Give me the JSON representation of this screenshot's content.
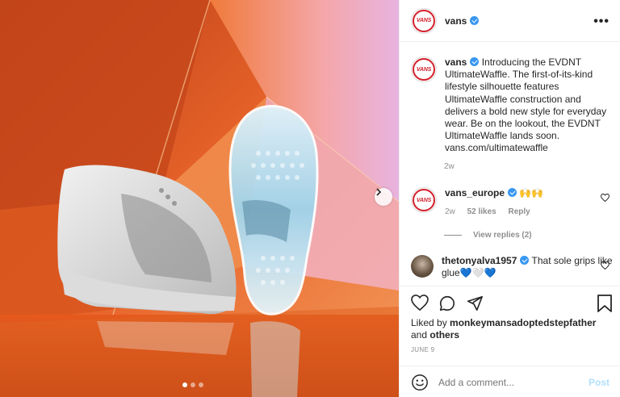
{
  "post": {
    "author": "vans",
    "author_logo_text": "VANS",
    "caption": "Introducing the EVDNT UltimateWaffle. The first-of-its-kind lifestyle silhouette features UltimateWaffle construction and delivers a bold new style for everyday wear. Be on the lookout, the EVDNT UltimateWaffle lands soon. vans.com/ultimatewaffle",
    "caption_time": "2w",
    "date": "JUNE 9"
  },
  "header": {
    "username": "vans",
    "more_label": "•••"
  },
  "comments": [
    {
      "username": "vans_europe",
      "avatar_logo_text": "VANS",
      "text": "🙌🙌",
      "time": "2w",
      "likes": "52 likes",
      "reply_label": "Reply"
    },
    {
      "username": "thetonyalva1957",
      "text": "That sole grips like glue💙🤍💙"
    }
  ],
  "view_replies_label": "View replies (2)",
  "likes": {
    "prefix": "Liked by",
    "user": "monkeymansadoptedstepfather",
    "and": "and",
    "others": "others"
  },
  "add_comment": {
    "placeholder": "Add a comment...",
    "post_label": "Post",
    "emoji_icon": "smiley-icon"
  },
  "carousel": {
    "slide_count": 3,
    "active_index": 0
  },
  "colors": {
    "verified": "#3897f0",
    "brand_red": "#d31f2b",
    "post_disabled": "#b2dffc"
  }
}
